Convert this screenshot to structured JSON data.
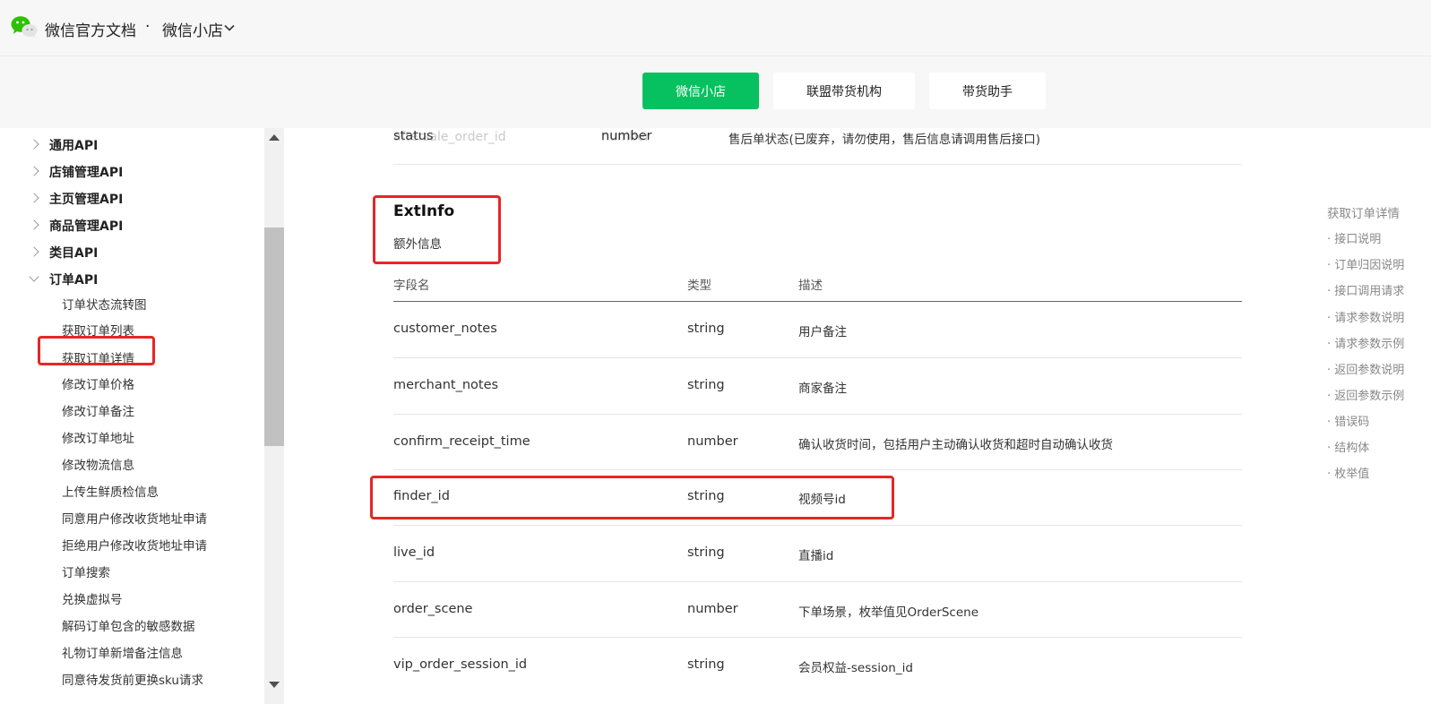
{
  "header": {
    "brand": "微信官方文档",
    "separator": "·",
    "product": "微信小店"
  },
  "tabs": [
    {
      "label": "微信小店",
      "active": true
    },
    {
      "label": "联盟带货机构",
      "active": false
    },
    {
      "label": "带货助手",
      "active": false
    }
  ],
  "faint_row": {
    "field": "aftersale_order_id",
    "type": "number"
  },
  "sidebar": {
    "categories": [
      {
        "label": "通用API"
      },
      {
        "label": "店铺管理API"
      },
      {
        "label": "主页管理API"
      },
      {
        "label": "商品管理API"
      },
      {
        "label": "类目API"
      },
      {
        "label": "订单API"
      }
    ],
    "items": [
      "订单状态流转图",
      "获取订单列表",
      "获取订单详情",
      "修改订单价格",
      "修改订单备注",
      "修改订单地址",
      "修改物流信息",
      "上传生鲜质检信息",
      "同意用户修改收货地址申请",
      "拒绝用户修改收货地址申请",
      "订单搜索",
      "兑换虚拟号",
      "解码订单包含的敏感数据",
      "礼物订单新增备注信息",
      "同意待发货前更换sku请求"
    ]
  },
  "status_row": {
    "field": "status",
    "type": "number",
    "desc": "售后单状态(已废弃，请勿使用，售后信息请调用售后接口)"
  },
  "section": {
    "title": "ExtInfo",
    "desc": "额外信息"
  },
  "table": {
    "headers": [
      "字段名",
      "类型",
      "描述"
    ],
    "rows": [
      {
        "field": "customer_notes",
        "type": "string",
        "desc": "用户备注"
      },
      {
        "field": "merchant_notes",
        "type": "string",
        "desc": "商家备注"
      },
      {
        "field": "confirm_receipt_time",
        "type": "number",
        "desc": "确认收货时间，包括用户主动确认收货和超时自动确认收货"
      },
      {
        "field": "finder_id",
        "type": "string",
        "desc": "视频号id"
      },
      {
        "field": "live_id",
        "type": "string",
        "desc": "直播id"
      },
      {
        "field": "order_scene",
        "type": "number",
        "desc": "下单场景，枚举值见OrderScene"
      },
      {
        "field": "vip_order_session_id",
        "type": "string",
        "desc": "会员权益-session_id"
      }
    ]
  },
  "toc": {
    "head": "获取订单详情",
    "items": [
      "· 接口说明",
      "· 订单归因说明",
      "· 接口调用请求",
      "· 请求参数说明",
      "· 请求参数示例",
      "· 返回参数说明",
      "· 返回参数示例",
      "· 错误码",
      "· 结构体",
      "· 枚举值"
    ]
  },
  "colors": {
    "accent": "#07c160",
    "highlight": "#e82525"
  }
}
